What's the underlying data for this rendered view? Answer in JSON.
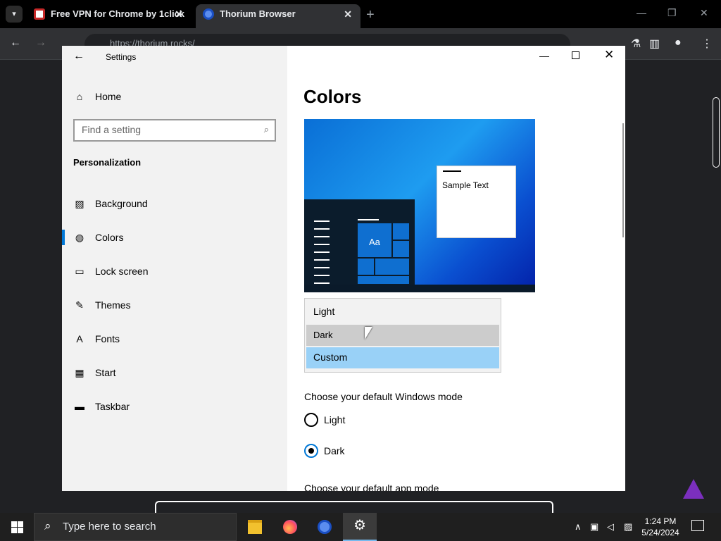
{
  "browser": {
    "tabs": [
      {
        "label": "Free VPN for Chrome by 1click"
      },
      {
        "label": "Thorium Browser"
      }
    ],
    "close_glyph": "✕",
    "new_tab_glyph": "+",
    "url": "https://thorium.rocks/",
    "minimize_glyph": "—",
    "restore_glyph": "❐",
    "close_window_glyph": "✕"
  },
  "settings": {
    "window_title": "Settings",
    "home_label": "Home",
    "search_placeholder": "Find a setting",
    "section": "Personalization",
    "nav": [
      {
        "label": "Background",
        "icon": "image-icon"
      },
      {
        "label": "Colors",
        "icon": "palette-icon"
      },
      {
        "label": "Lock screen",
        "icon": "lock-screen-icon"
      },
      {
        "label": "Themes",
        "icon": "themes-icon"
      },
      {
        "label": "Fonts",
        "icon": "fonts-icon"
      },
      {
        "label": "Start",
        "icon": "start-icon"
      },
      {
        "label": "Taskbar",
        "icon": "taskbar-icon"
      }
    ],
    "selected_nav": "Colors",
    "page_title": "Colors",
    "preview": {
      "sample_text": "Sample Text",
      "tile_text": "Aa"
    },
    "dropdown_options": [
      "Light",
      "Dark",
      "Custom"
    ],
    "dropdown_selected": "Custom",
    "dropdown_hovered": "Dark",
    "windows_mode": {
      "label": "Choose your default Windows mode",
      "options": [
        "Light",
        "Dark"
      ],
      "selected": "Dark"
    },
    "app_mode_label": "Choose your default app mode",
    "accent_color": "#0078d7"
  },
  "taskbar": {
    "search_placeholder": "Type here to search",
    "apps": [
      "file-explorer-icon",
      "firefox-icon",
      "thorium-icon",
      "settings-gear-icon"
    ],
    "time": "1:24 PM",
    "date": "5/24/2024"
  }
}
